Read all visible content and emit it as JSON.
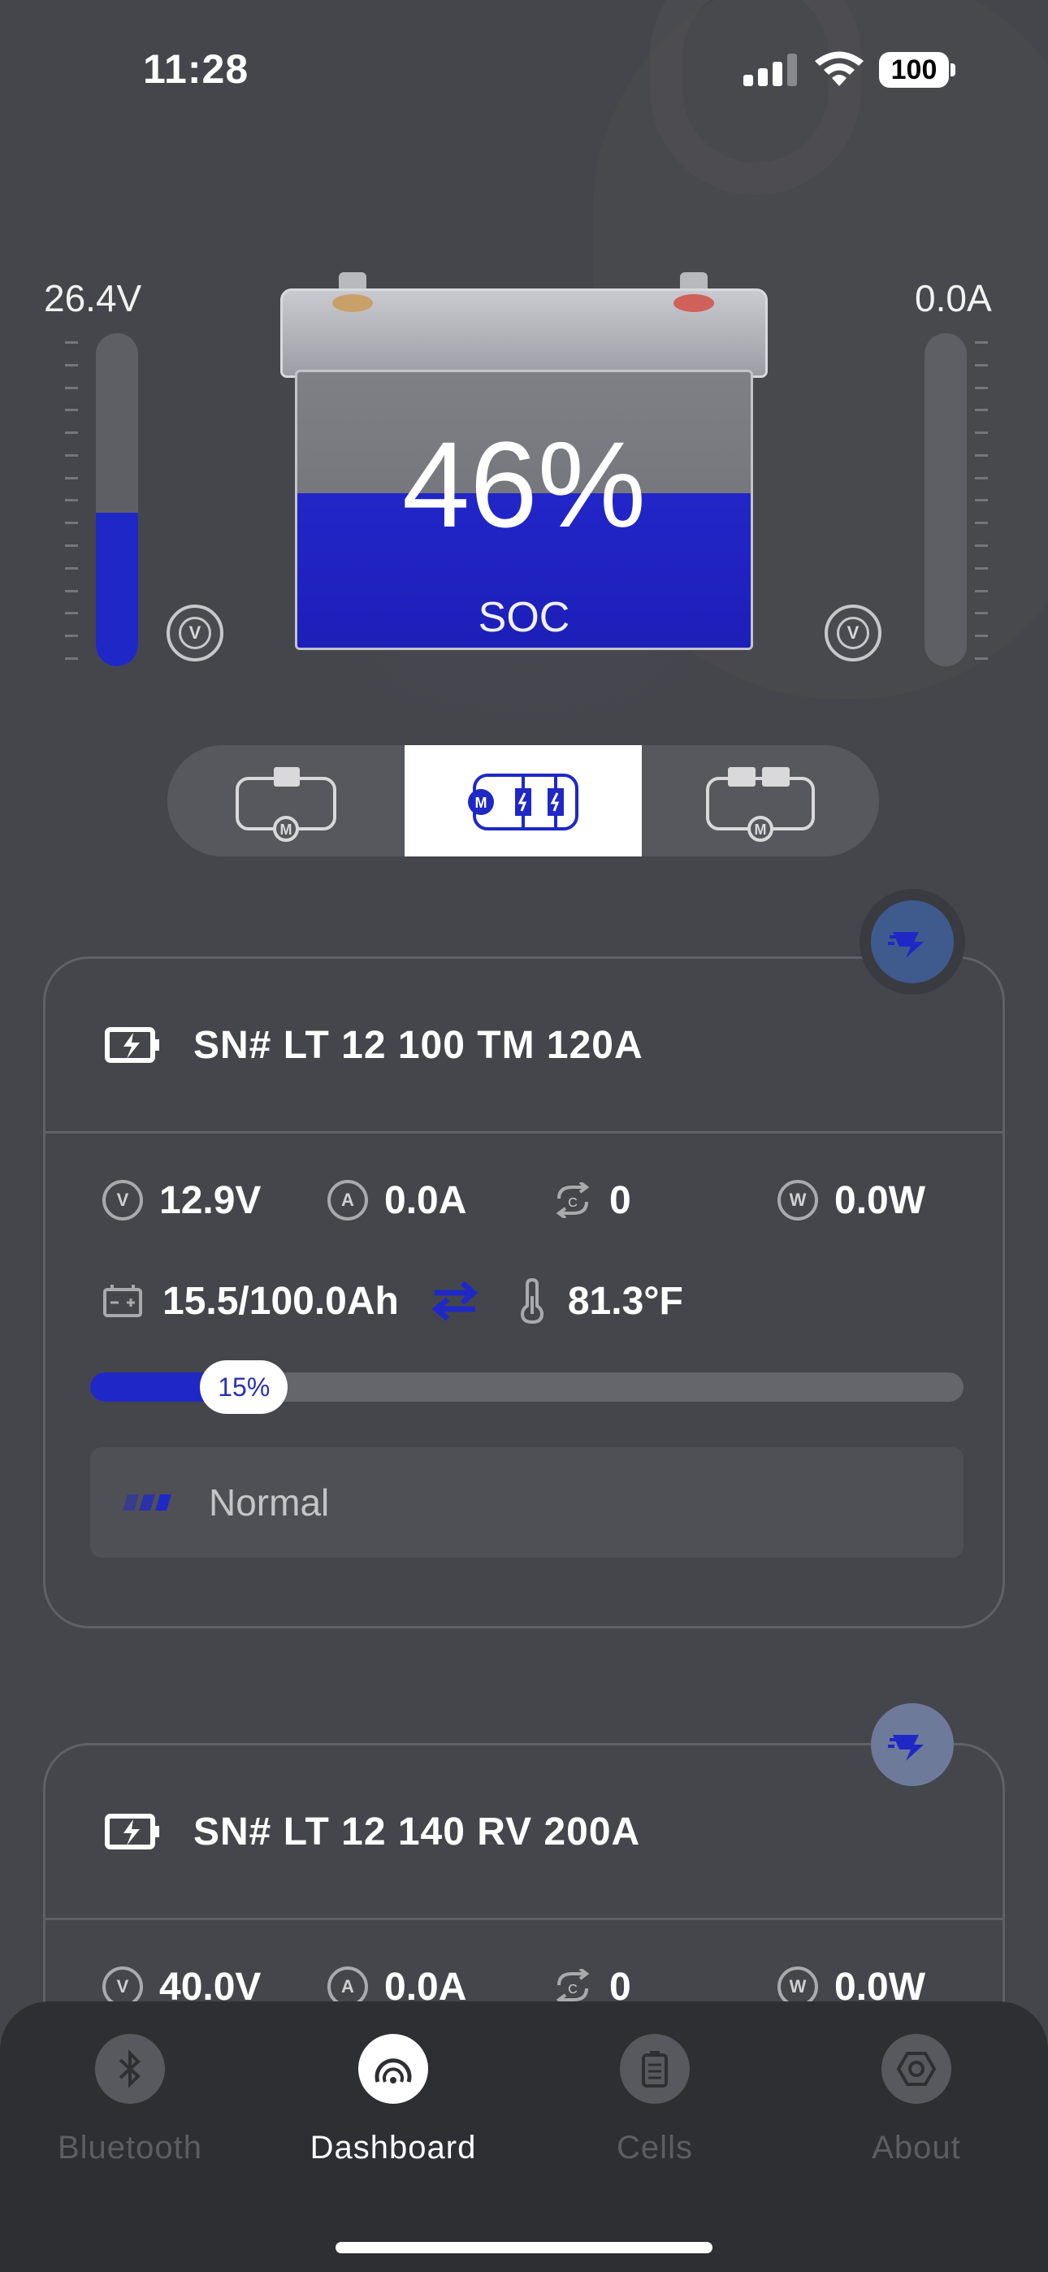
{
  "status_bar": {
    "time": "11:28",
    "battery": "100"
  },
  "gauges": {
    "voltage": {
      "value": "26.4V",
      "fill_fraction": 0.46,
      "unit_icon": "V"
    },
    "current": {
      "value": "0.0A",
      "fill_fraction": 0.0,
      "unit_icon": "V"
    }
  },
  "battery": {
    "soc_value": "46%",
    "soc_label": "SOC",
    "soc_fraction": 0.46
  },
  "modes": [
    {
      "name": "single-battery-mode",
      "active": false
    },
    {
      "name": "parallel-mode",
      "active": true
    },
    {
      "name": "series-mode",
      "active": false
    }
  ],
  "cards": [
    {
      "title": "SN# LT 12 100 TM 120A",
      "voltage": "12.9V",
      "current": "0.0A",
      "cycles": "0",
      "power": "0.0W",
      "capacity": "15.5/100.0Ah",
      "temperature": "81.3°F",
      "progress_label": "15%",
      "progress_fraction": 0.15,
      "status": "Normal"
    },
    {
      "title": "SN# LT 12 140 RV 200A",
      "voltage": "40.0V",
      "current": "0.0A",
      "cycles": "0",
      "power": "0.0W"
    }
  ],
  "tabs": [
    {
      "label": "Bluetooth",
      "icon": "bluetooth-icon",
      "active": false
    },
    {
      "label": "Dashboard",
      "icon": "gauge-icon",
      "active": true
    },
    {
      "label": "Cells",
      "icon": "cells-icon",
      "active": false
    },
    {
      "label": "About",
      "icon": "hexagon-icon",
      "active": false
    }
  ],
  "colors": {
    "accent": "#1f28c6",
    "background": "#45464b",
    "tabbar": "#2e2f33"
  }
}
